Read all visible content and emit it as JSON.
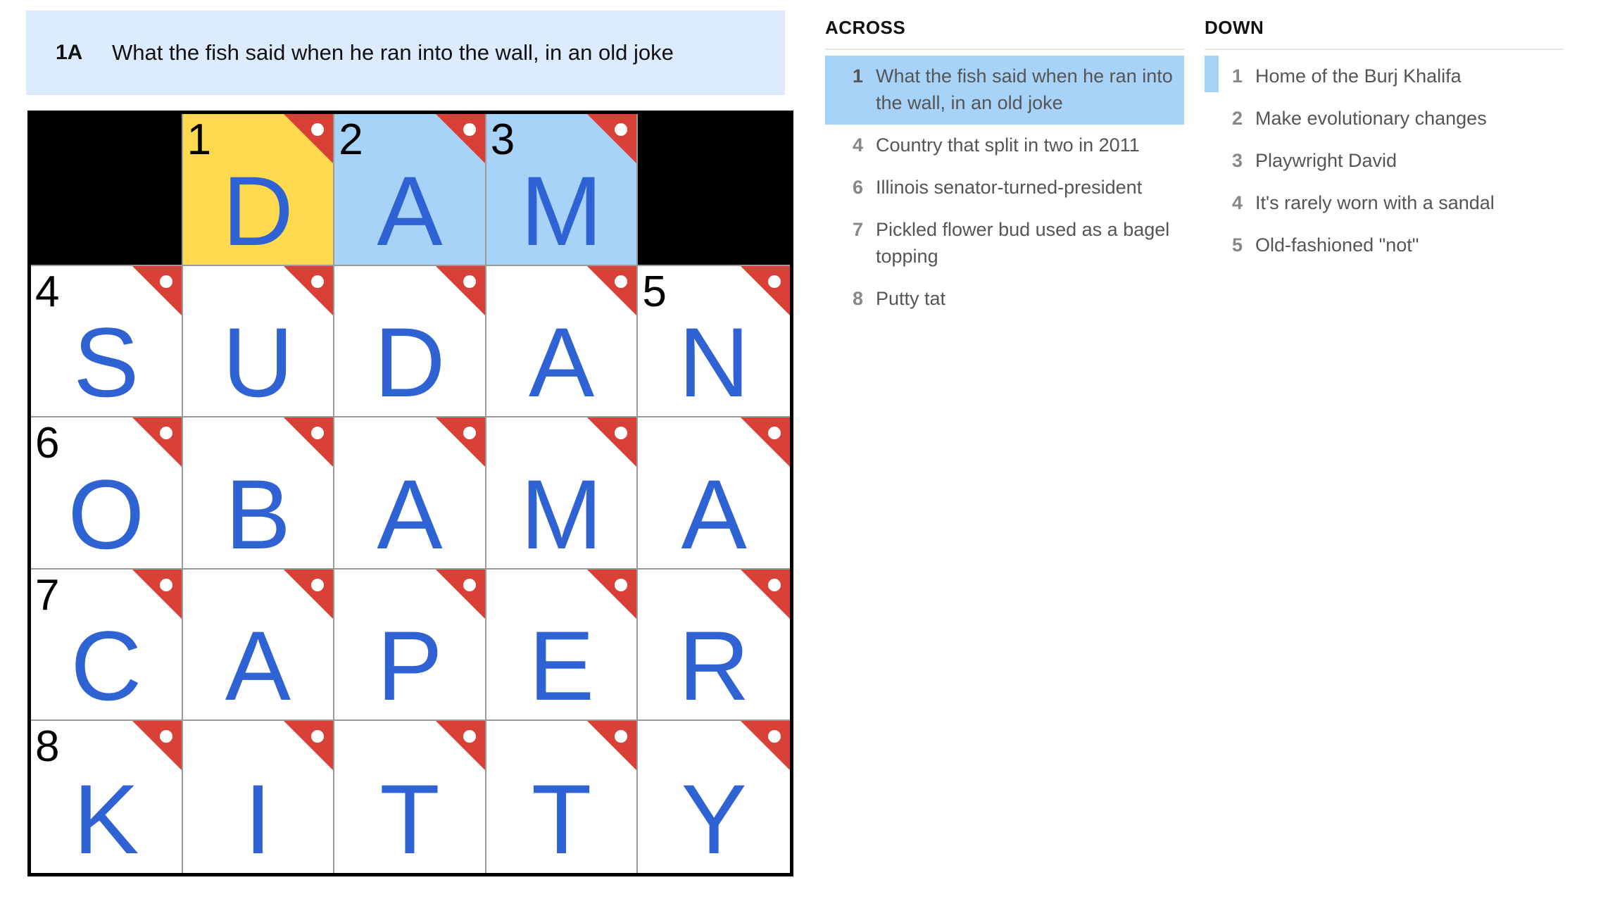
{
  "current_clue": {
    "label": "1A",
    "text": "What the fish said when he ran into the wall, in an old joke"
  },
  "colors": {
    "selected_cell": "#ffda4e",
    "highlighted_cell": "#a7d3f9",
    "letter": "#2f63d3",
    "flag": "#d94138",
    "clue_bar": "#dcebfd"
  },
  "board": {
    "rows": [
      [
        {
          "block": true
        },
        {
          "num": "1",
          "letter": "D",
          "state": "selected",
          "flag": true
        },
        {
          "num": "2",
          "letter": "A",
          "state": "highlighted",
          "flag": true
        },
        {
          "num": "3",
          "letter": "M",
          "state": "highlighted",
          "flag": true
        },
        {
          "block": true
        }
      ],
      [
        {
          "num": "4",
          "letter": "S",
          "flag": true
        },
        {
          "num": "",
          "letter": "U",
          "flag": true
        },
        {
          "num": "",
          "letter": "D",
          "flag": true
        },
        {
          "num": "",
          "letter": "A",
          "flag": true
        },
        {
          "num": "5",
          "letter": "N",
          "flag": true
        }
      ],
      [
        {
          "num": "6",
          "letter": "O",
          "flag": true
        },
        {
          "num": "",
          "letter": "B",
          "flag": true
        },
        {
          "num": "",
          "letter": "A",
          "flag": true
        },
        {
          "num": "",
          "letter": "M",
          "flag": true
        },
        {
          "num": "",
          "letter": "A",
          "flag": true
        }
      ],
      [
        {
          "num": "7",
          "letter": "C",
          "flag": true
        },
        {
          "num": "",
          "letter": "A",
          "flag": true
        },
        {
          "num": "",
          "letter": "P",
          "flag": true
        },
        {
          "num": "",
          "letter": "E",
          "flag": true
        },
        {
          "num": "",
          "letter": "R",
          "flag": true
        }
      ],
      [
        {
          "num": "8",
          "letter": "K",
          "flag": true
        },
        {
          "num": "",
          "letter": "I",
          "flag": true
        },
        {
          "num": "",
          "letter": "T",
          "flag": true
        },
        {
          "num": "",
          "letter": "T",
          "flag": true
        },
        {
          "num": "",
          "letter": "Y",
          "flag": true
        }
      ]
    ]
  },
  "across": {
    "title": "ACROSS",
    "clues": [
      {
        "num": "1",
        "text": "What the fish said when he ran into the wall, in an old joke",
        "state": "active"
      },
      {
        "num": "4",
        "text": "Country that split in two in 2011"
      },
      {
        "num": "6",
        "text": "Illinois senator-turned-president"
      },
      {
        "num": "7",
        "text": "Pickled flower bud used as a bagel topping"
      },
      {
        "num": "8",
        "text": "Putty tat"
      }
    ]
  },
  "down": {
    "title": "DOWN",
    "clues": [
      {
        "num": "1",
        "text": "Home of the Burj Khalifa",
        "state": "cross"
      },
      {
        "num": "2",
        "text": "Make evolutionary changes"
      },
      {
        "num": "3",
        "text": "Playwright David"
      },
      {
        "num": "4",
        "text": "It's rarely worn with a sandal"
      },
      {
        "num": "5",
        "text": "Old-fashioned \"not\""
      }
    ]
  }
}
